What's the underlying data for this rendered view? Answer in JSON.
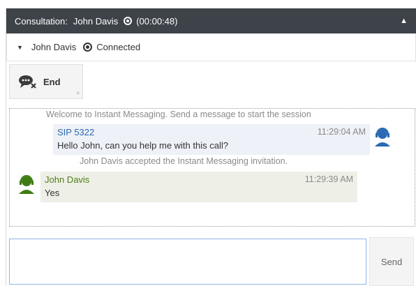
{
  "header": {
    "label": "Consultation:",
    "contact": "John Davis",
    "timer": "(00:00:48)",
    "collapse_icon": "chevron-up-icon"
  },
  "party": {
    "name": "John Davis",
    "status": "Connected"
  },
  "toolbar": {
    "end_label": "End",
    "end_icon": "end-chat-icon"
  },
  "transcript": {
    "welcome": "Welcome to Instant Messaging. Send a message to start the session",
    "messages": [
      {
        "sender": "SIP 5322",
        "time": "11:29:04 AM",
        "text": "Hello John, can you help me with this call?",
        "color": "#2a69b3"
      },
      {
        "sender": "John Davis",
        "time": "11:29:39 AM",
        "text": "Yes",
        "color": "#4f7a1a"
      }
    ],
    "accepted_notice": "John Davis accepted the Instant Messaging invitation."
  },
  "composer": {
    "value": "",
    "placeholder": "",
    "send_label": "Send"
  },
  "colors": {
    "header_bg": "#3e4349",
    "agent_name": "#2a69b3",
    "customer_name": "#4f7a1a",
    "agent_avatar": "#2a69b3",
    "customer_avatar": "#3f7d14"
  }
}
